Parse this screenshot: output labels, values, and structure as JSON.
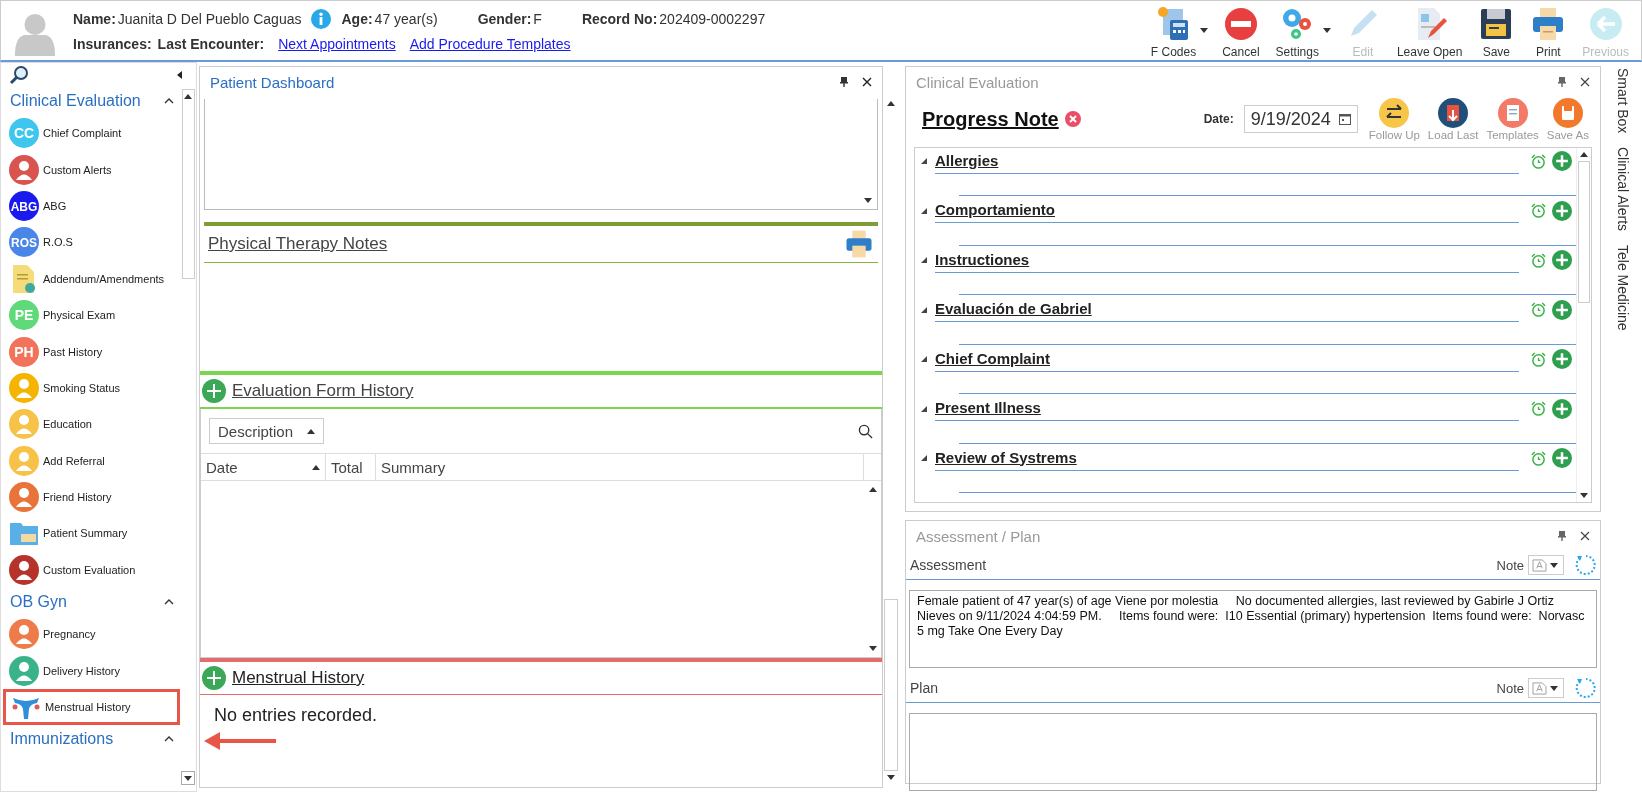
{
  "header": {
    "name_label": "Name:",
    "name": "Juanita D Del Pueblo Caguas",
    "age_label": "Age:",
    "age": "47 year(s)",
    "gender_label": "Gender:",
    "gender": "F",
    "record_label": "Record No:",
    "record": "202409-0002297",
    "insurances_label": "Insurances:",
    "last_encounter_label": "Last Encounter:",
    "links": [
      "Next Appointments",
      "Add Procedure Templates"
    ]
  },
  "toolbar": [
    {
      "label": "F Codes",
      "kind": "fcodes",
      "dropdown": true,
      "disabled": false
    },
    {
      "label": "Cancel",
      "kind": "cancel",
      "dropdown": false,
      "disabled": false
    },
    {
      "label": "Settings",
      "kind": "settings",
      "dropdown": true,
      "disabled": false
    },
    {
      "label": "Edit",
      "kind": "edit",
      "dropdown": false,
      "disabled": true
    },
    {
      "label": "Leave Open",
      "kind": "leave",
      "dropdown": false,
      "disabled": false
    },
    {
      "label": "Save",
      "kind": "save",
      "dropdown": false,
      "disabled": false
    },
    {
      "label": "Print",
      "kind": "print",
      "dropdown": false,
      "disabled": false
    },
    {
      "label": "Previous",
      "kind": "previous",
      "dropdown": false,
      "disabled": true
    }
  ],
  "sidebar": {
    "sections": [
      {
        "title": "Clinical Evaluation",
        "expanded": true,
        "items": [
          {
            "label": "Chief Complaint",
            "kind": "initials",
            "initials": "CC",
            "color": "#3fc6ee",
            "highlighted": false
          },
          {
            "label": "Custom Alerts",
            "kind": "round",
            "color": "#d9534f",
            "highlighted": false
          },
          {
            "label": "ABG",
            "kind": "initials",
            "initials": "ABG",
            "color": "#1a1aee",
            "highlighted": false
          },
          {
            "label": "R.O.S",
            "kind": "initials",
            "initials": "ROS",
            "color": "#4a86e8",
            "highlighted": false
          },
          {
            "label": "Addendum/Amendments",
            "kind": "document",
            "color": "#f4dc7a",
            "highlighted": false
          },
          {
            "label": "Physical Exam",
            "kind": "initials",
            "initials": "PE",
            "color": "#5fd97a",
            "highlighted": false
          },
          {
            "label": "Past History",
            "kind": "initials",
            "initials": "PH",
            "color": "#f2725a",
            "highlighted": false
          },
          {
            "label": "Smoking Status",
            "kind": "round",
            "color": "#f5b400",
            "highlighted": false
          },
          {
            "label": "Education",
            "kind": "round",
            "color": "#f7c248",
            "highlighted": false
          },
          {
            "label": "Add Referral",
            "kind": "round",
            "color": "#f7c248",
            "highlighted": false
          },
          {
            "label": "Friend History",
            "kind": "round",
            "color": "#e8743b",
            "highlighted": false
          },
          {
            "label": "Patient Summary",
            "kind": "folder",
            "color": "#5aafe6",
            "highlighted": false
          },
          {
            "label": "Custom Evaluation",
            "kind": "round",
            "color": "#b5332a",
            "highlighted": false
          }
        ]
      },
      {
        "title": "OB Gyn",
        "expanded": true,
        "items": [
          {
            "label": "Pregnancy",
            "kind": "round",
            "color": "#ef7a4a",
            "highlighted": false
          },
          {
            "label": "Delivery History",
            "kind": "round",
            "color": "#3bb38a",
            "highlighted": false
          },
          {
            "label": "Menstrual History",
            "kind": "uterus",
            "color": "#2f8fd8",
            "highlighted": true
          }
        ]
      },
      {
        "title": "Immunizations",
        "expanded": true
      }
    ]
  },
  "dashboard": {
    "title": "Patient Dashboard",
    "pt_notes_title": "Physical Therapy Notes",
    "eval_history": {
      "title": "Evaluation Form History",
      "group_by": "Description",
      "columns": [
        {
          "label": "Date",
          "sorted": true
        },
        {
          "label": "Total",
          "sorted": false
        },
        {
          "label": "Summary",
          "sorted": false
        }
      ]
    },
    "menstrual": {
      "title": "Menstrual History",
      "empty_text": "No entries recorded."
    }
  },
  "clinical": {
    "title": "Clinical Evaluation",
    "note_title": "Progress Note",
    "date_label": "Date:",
    "date": "9/19/2024",
    "actions": [
      {
        "label": "Follow Up",
        "kind": "follow"
      },
      {
        "label": "Load Last",
        "kind": "load"
      },
      {
        "label": "Templates",
        "kind": "templates"
      },
      {
        "label": "Save As",
        "kind": "saveas"
      }
    ],
    "sections": [
      {
        "title": "Allergies",
        "expanded": true
      },
      {
        "title": "Comportamiento",
        "expanded": true
      },
      {
        "title": "Instructiones",
        "expanded": true
      },
      {
        "title": "Evaluación de Gabriel",
        "expanded": true
      },
      {
        "title": "Chief Complaint",
        "expanded": true
      },
      {
        "title": "Present Illness",
        "expanded": true
      },
      {
        "title": "Review of Systrems",
        "expanded": true
      }
    ]
  },
  "assessment": {
    "title": "Assessment / Plan",
    "fields": [
      {
        "label": "Assessment",
        "note_label": "Note",
        "text": "Female patient of 47 year(s) of age Viene por molestia     No documented allergies, last reviewed by Gabirle J Ortiz Nieves on 9/11/2024 4:04:59 PM.     Items found were:  I10 Essential (primary) hypertension  Items found were:  Norvasc 5 mg Take One Every Day"
      },
      {
        "label": "Plan",
        "note_label": "Note"
      }
    ]
  },
  "side_tabs": [
    "Smart Box",
    "Clinical Alerts",
    "Tele Medicine"
  ]
}
